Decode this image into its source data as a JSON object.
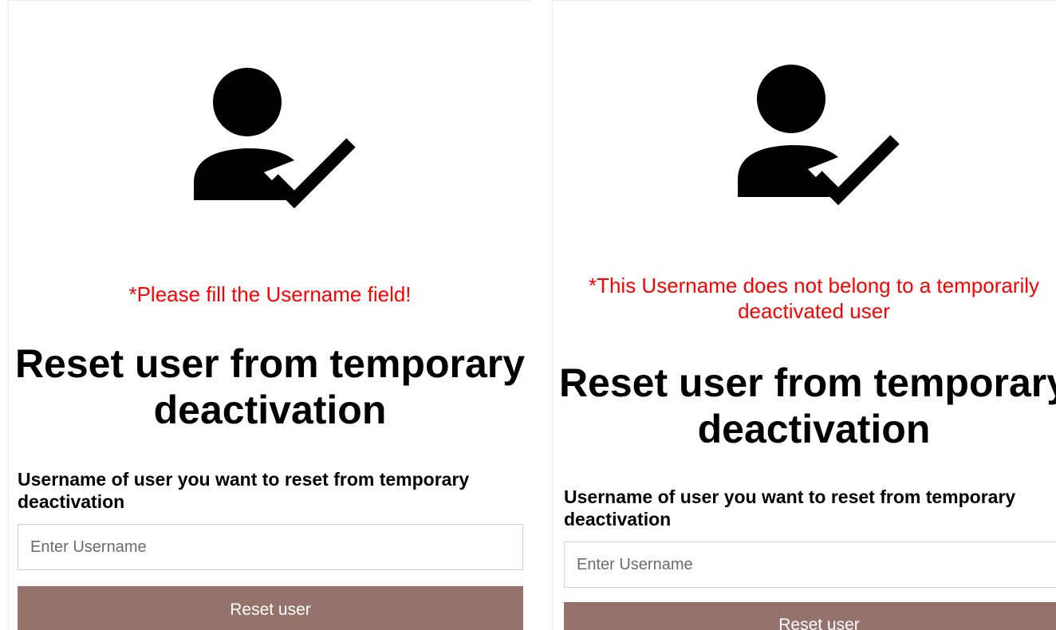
{
  "panels": [
    {
      "icon": "user-check-icon",
      "error_message": "*Please fill the Username field!",
      "heading": "Reset user from temporary deactivation",
      "field_label": "Username of user you want to reset from temporary deactivation",
      "username_input": {
        "value": "",
        "placeholder": "Enter Username"
      },
      "reset_button_label": "Reset user"
    },
    {
      "icon": "user-check-icon",
      "error_message": "*This Username does not belong to a temporarily deactivated user",
      "heading": "Reset user from temporary deactivation",
      "field_label": "Username of user you want to reset from temporary deactivation",
      "username_input": {
        "value": "",
        "placeholder": "Enter Username"
      },
      "reset_button_label": "Reset user"
    }
  ],
  "colors": {
    "error": "#ff0000",
    "button_background": "#95736c",
    "button_text": "#ffffff"
  }
}
